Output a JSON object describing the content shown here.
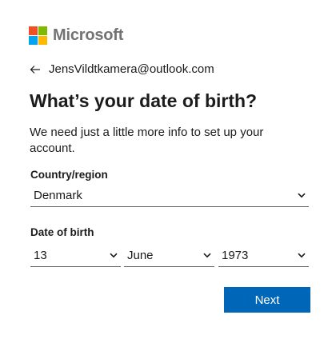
{
  "brand": {
    "name": "Microsoft",
    "logo_colors": [
      "#f25022",
      "#7fba00",
      "#00a4ef",
      "#ffb900"
    ],
    "icon": "microsoft-logo"
  },
  "identity": {
    "email": "JensVildtkamera@outlook.com",
    "back_icon": "back-arrow-icon"
  },
  "page": {
    "title": "What’s your date of birth?",
    "description": "We need just a little more info to set up your account."
  },
  "country": {
    "label": "Country/region",
    "selected": "Denmark"
  },
  "dob": {
    "label": "Date of birth",
    "day": "13",
    "month": "June",
    "year": "1973"
  },
  "actions": {
    "next_label": "Next",
    "accent_color": "#0067b8"
  }
}
